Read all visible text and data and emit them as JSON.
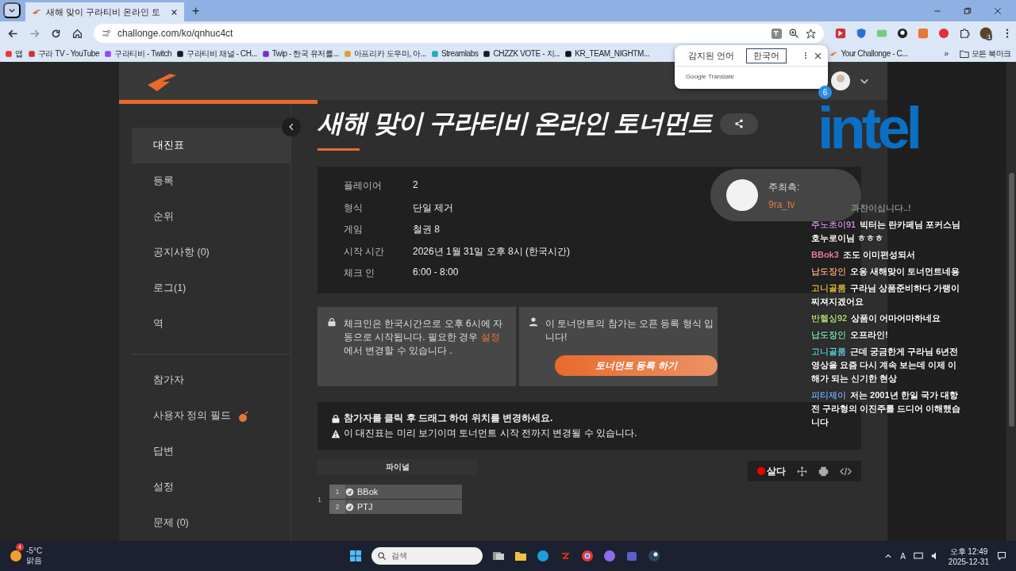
{
  "browser": {
    "tabs": [
      {
        "title": "새해 맞이 구라티비 온라인 토",
        "selected": true
      }
    ],
    "new_tab": "+",
    "url": "challonge.com/ko/qnhuc4ct",
    "extension_badge": "1",
    "bookmarks": [
      {
        "label": "앱"
      },
      {
        "label": "구라 TV - YouTube"
      },
      {
        "label": "구라티비 - Twitch"
      },
      {
        "label": "구라티비 채널 - CH..."
      },
      {
        "label": "Twip - 한국 유저를..."
      },
      {
        "label": "아프리카 도우미, 아..."
      },
      {
        "label": "Streamlabs"
      },
      {
        "label": "CHZZK VOTE - 지..."
      },
      {
        "label": "KR_TEAM_NIGHTM..."
      },
      {
        "label": "Your Challonge - C..."
      }
    ],
    "more": "»",
    "all_bookmarks": "모든 북마크"
  },
  "translate_popup": {
    "tabs": [
      {
        "label": "감지된 언어",
        "selected": false
      },
      {
        "label": "한국어",
        "selected": true
      }
    ],
    "brand": "Google Translate"
  },
  "header": {
    "notification_count": "6"
  },
  "sidebar": {
    "sections": [
      {
        "items": [
          {
            "label": "대진표",
            "selected": true,
            "has_icon": false
          },
          {
            "label": "등록",
            "selected": false,
            "has_icon": false
          },
          {
            "label": "순위",
            "selected": false,
            "has_icon": false
          },
          {
            "label": "공지사항 (0)",
            "selected": false,
            "has_icon": false
          },
          {
            "label": "로그(1)",
            "selected": false,
            "has_icon": false
          },
          {
            "label": "역",
            "selected": false,
            "has_icon": false
          }
        ]
      },
      {
        "items": [
          {
            "label": "참가자",
            "selected": false,
            "has_icon": false
          },
          {
            "label": "사용자 정의 필드",
            "selected": false,
            "has_icon": true
          },
          {
            "label": "답변",
            "selected": false,
            "has_icon": false
          },
          {
            "label": "설정",
            "selected": false,
            "has_icon": false
          },
          {
            "label": "문제 (0)",
            "selected": false,
            "has_icon": false
          }
        ]
      }
    ]
  },
  "tournament": {
    "title": "새해 맞이 구라티비 온라인 토너먼트",
    "info": [
      {
        "label": "플레이어",
        "value": "2"
      },
      {
        "label": "형식",
        "value": "단일 제거"
      },
      {
        "label": "게임",
        "value": "철권 8"
      },
      {
        "label": "시작 시간",
        "value": "2026년 1월 31일 오후 8시 (한국시간)"
      },
      {
        "label": "체크 인",
        "value": "6:00 - 8:00"
      }
    ],
    "host": {
      "label": "주최측:",
      "name": "9ra_tv"
    },
    "checkin_notice": {
      "before": "체크인은 한국시간으로 오후 6시에 자동으로 시작됩니다. 필요한 경우",
      "link": "설정",
      "after": "에서 변경할 수 있습니다 ."
    },
    "registration_notice": "이 토너먼트의 참가는 오픈 등록 형식 입니다!",
    "register_button": "토너먼트 등록 하기",
    "hints": [
      {
        "kind": "lock",
        "text": "참가자를 클릭 후 드래그 하여 위치를 변경하세요."
      },
      {
        "kind": "warning",
        "text": "이 대진표는 미리 보기이며 토너먼트 시작 전까지 변경될 수 있습니다."
      }
    ],
    "bracket": {
      "round": "파이널",
      "match": "1",
      "players": [
        {
          "seed": "1",
          "name": "BBok"
        },
        {
          "seed": "2",
          "name": "PTJ"
        }
      ]
    },
    "toolbar": {
      "live": "살다"
    }
  },
  "overlay": {
    "sponsor_logo": "intel",
    "chat_partial": "과찬이십니다..!",
    "messages": [
      {
        "user": "주노초이91",
        "color": "#c48ad0",
        "text": "빅터는 란카페님 포커스님 호누로이님 ㅎㅎㅎ"
      },
      {
        "user": "BBok3",
        "color": "#e8839f",
        "text": "조도 이미편성되서"
      },
      {
        "user": "납도장인",
        "color": "#e0a07c",
        "text": "오옹 새해맞이 토너먼트네용"
      },
      {
        "user": "고니골룸",
        "color": "#e0b848",
        "text": "구라님 상품준비하다 가랭이 찌져지겠어요"
      },
      {
        "user": "반헬싱92",
        "color": "#b4d87a",
        "text": "상품이 어마어마하네요"
      },
      {
        "user": "납도장인",
        "color": "#7fd6a8",
        "text": "오프라인!"
      },
      {
        "user": "고니골룸",
        "color": "#62c6d8",
        "text": "근데 궁금한게 구라님 6년전 영상을 요즘 다시 계속 보는데 이제 이해가 되는 신기한 현상"
      },
      {
        "user": "피티제이",
        "color": "#7aa8e8",
        "text": "저는 2001년 한일 국가 대항전 구라형의 이진주를 드디어 이해했습니다"
      }
    ]
  },
  "taskbar": {
    "weather_badge": "4",
    "temperature": "-5°C",
    "weather": "맑음",
    "search": "검색",
    "ime": "A",
    "time": "오후 12:49",
    "date": "2025-12-31"
  }
}
